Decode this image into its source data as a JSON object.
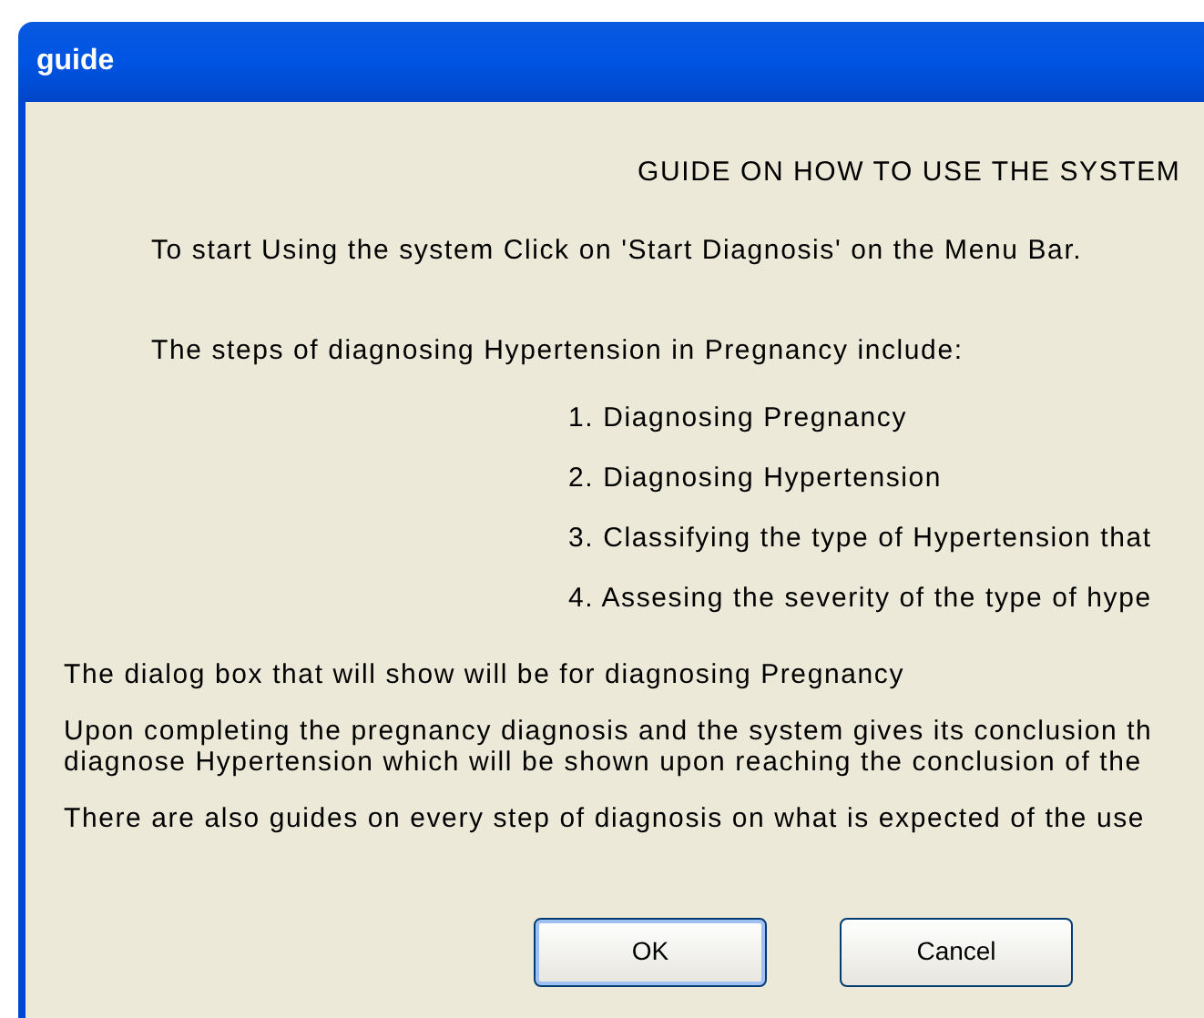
{
  "window": {
    "title": "guide"
  },
  "heading": "GUIDE ON HOW TO USE THE SYSTEM",
  "intro": "To start Using the system Click on 'Start Diagnosis' on the Menu Bar.",
  "steps_intro": "The steps of diagnosing Hypertension in Pregnancy include:",
  "steps": [
    "1. Diagnosing Pregnancy",
    "2. Diagnosing Hypertension",
    "3. Classifying the type of Hypertension that",
    "4. Assesing the severity of the type of hype"
  ],
  "notes": [
    [
      "The dialog box that will show will be for diagnosing Pregnancy"
    ],
    [
      "Upon completing the pregnancy diagnosis and the system gives its conclusion th",
      "diagnose Hypertension which will be shown upon reaching the conclusion of the"
    ],
    [
      "There are also guides on every step of diagnosis on what is expected of the use"
    ]
  ],
  "buttons": [
    {
      "label": "OK",
      "default": true
    },
    {
      "label": "Cancel",
      "default": false
    }
  ]
}
